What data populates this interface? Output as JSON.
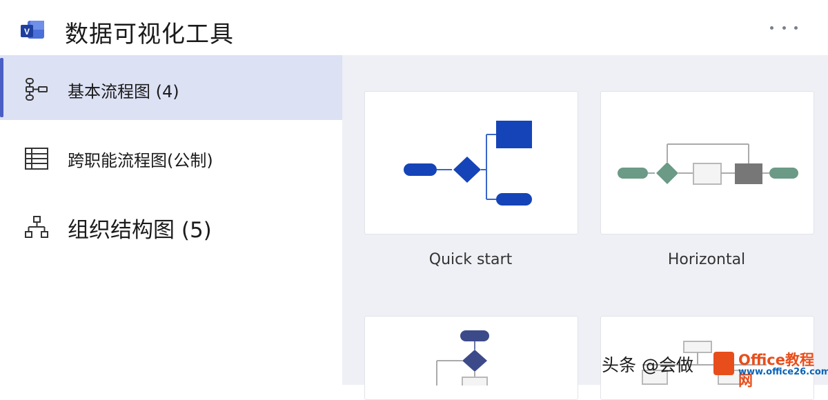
{
  "app": {
    "title": "数据可视化工具"
  },
  "sidebar": {
    "items": [
      {
        "label": "基本流程图 (4)",
        "icon": "basic-flowchart-icon",
        "selected": true
      },
      {
        "label": "跨职能流程图(公制)",
        "icon": "table-grid-icon",
        "selected": false
      },
      {
        "label": "组织结构图 (5)",
        "icon": "org-chart-icon",
        "selected": false
      }
    ]
  },
  "templates": [
    {
      "label": "Quick start"
    },
    {
      "label": "Horizontal"
    }
  ],
  "footer": {
    "attribution": "头条 @会做",
    "site_name": "Office教程网",
    "site_url": "www.office26.com"
  },
  "colors": {
    "accent": "#4a5ec4",
    "selected_bg": "#dde1f4",
    "flow_blue": "#1544b8",
    "flow_green": "#6b9a86",
    "flow_gray": "#777777"
  }
}
